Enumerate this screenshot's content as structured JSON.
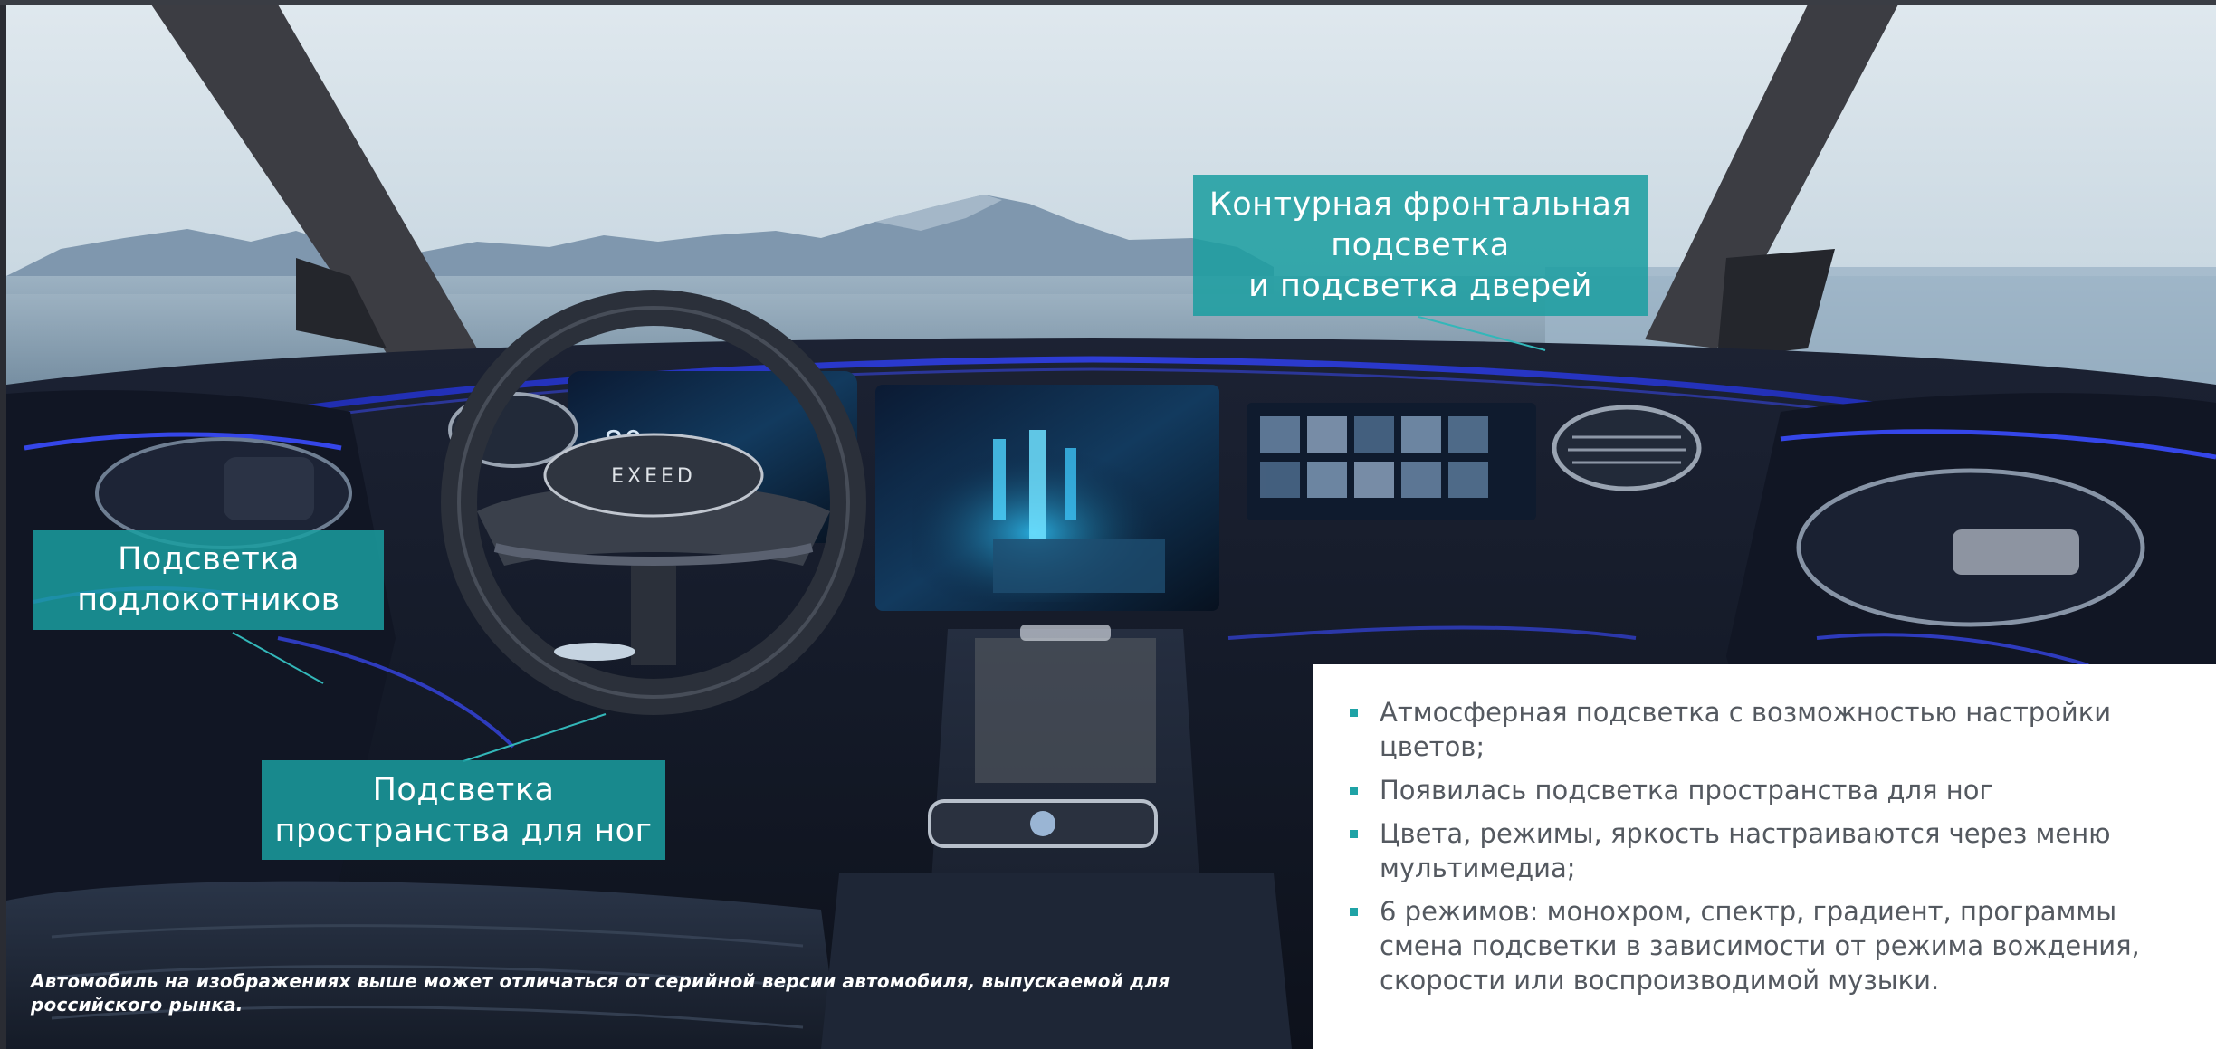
{
  "slide": {
    "photo_alt": "Интерьер автомобиля EXEED с атмосферной подсветкой",
    "colors": {
      "callout_bg": "#1a9ea0",
      "bullet_marker": "#1fa3a6",
      "ambient_light": "#2430c8",
      "panel_bg": "#ffffff",
      "text": "#545960"
    }
  },
  "callouts": {
    "front": [
      "Контурная фронтальная",
      "подсветка",
      "и подсветка дверей"
    ],
    "armrest": [
      "Подсветка",
      "подлокотников"
    ],
    "footwell": [
      "Подсветка",
      "пространства для ног"
    ]
  },
  "bullets": [
    "Атмосферная подсветка с возможностью настройки цветов;",
    "Появилась подсветка пространства для ног",
    "Цвета, режимы, яркость настраиваются через меню мультимедиа;",
    "6 режимов: монохром, спектр, градиент, программы смена подсветки в зависимости от режима вождения, скорости или воспроизводимой музыки."
  ],
  "disclaimer": "Автомобиль на изображениях выше может отличаться от серийной версии автомобиля, выпускаемой для российского рынка.",
  "photo_labels": {
    "steering_wheel_logo": "EXEED",
    "cluster_speed": "80"
  }
}
